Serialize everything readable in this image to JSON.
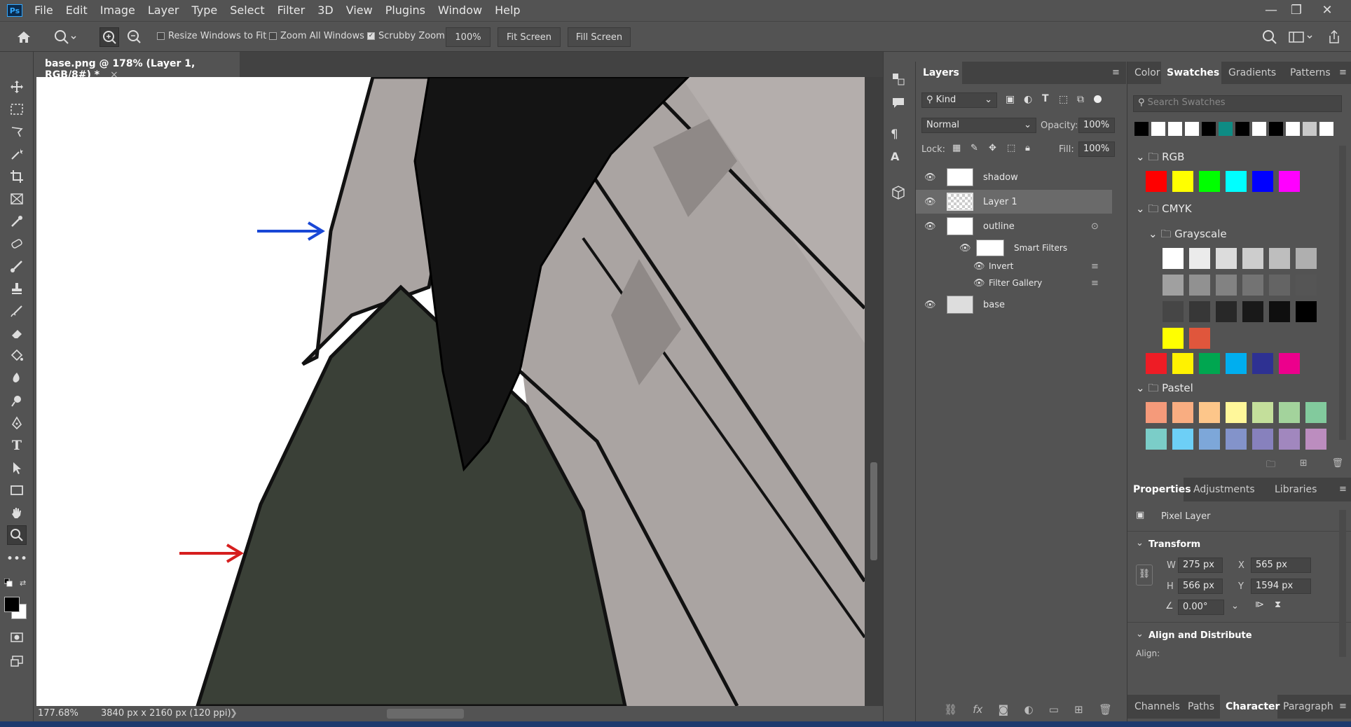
{
  "menu": {
    "app_logo": "Ps",
    "items": [
      "File",
      "Edit",
      "Image",
      "Layer",
      "Type",
      "Select",
      "Filter",
      "3D",
      "View",
      "Plugins",
      "Window",
      "Help"
    ]
  },
  "window_controls": {
    "minimize": "—",
    "restore": "❐",
    "close": "✕"
  },
  "options_bar": {
    "resize_windows": {
      "label": "Resize Windows to Fit",
      "checked": false
    },
    "zoom_all": {
      "label": "Zoom All Windows",
      "checked": false
    },
    "scrubby_zoom": {
      "label": "Scrubby Zoom",
      "checked": true
    },
    "zoom_value": "100%",
    "fit_screen": "Fit Screen",
    "fill_screen": "Fill Screen"
  },
  "document_tab": {
    "title": "base.png @ 178% (Layer 1, RGB/8#) *",
    "close": "×"
  },
  "status": {
    "zoom": "177.68%",
    "dimensions": "3840 px x 2160 px (120 ppi)",
    "arrow": "❯"
  },
  "layers_panel": {
    "tab": "Layers",
    "filter_kind": "Kind",
    "blend_mode": "Normal",
    "opacity_label": "Opacity:",
    "opacity": "100%",
    "lock_label": "Lock:",
    "fill_label": "Fill:",
    "fill": "100%",
    "layers": [
      {
        "name": "shadow",
        "selected": false
      },
      {
        "name": "Layer 1",
        "selected": true
      },
      {
        "name": "outline",
        "selected": false
      },
      {
        "name": "base",
        "selected": false
      }
    ],
    "smart_filters": {
      "label": "Smart Filters",
      "items": [
        "Invert",
        "Filter Gallery"
      ]
    }
  },
  "swatches_panel": {
    "tabs": [
      "Color",
      "Swatches",
      "Gradients",
      "Patterns"
    ],
    "active_tab": "Swatches",
    "search_placeholder": "Search Swatches",
    "recent": [
      "#000000",
      "#ffffff",
      "#ffffff",
      "#ffffff",
      "#000000",
      "#0e8c84",
      "#000000",
      "#ffffff",
      "#000000",
      "#ffffff",
      "#c8c8c8",
      "#ffffff"
    ],
    "groups": {
      "rgb": {
        "name": "RGB",
        "colors": [
          "#ff0000",
          "#ffff00",
          "#00ff00",
          "#00ffff",
          "#0000ff",
          "#ff00ff"
        ]
      },
      "cmyk": {
        "name": "CMYK"
      },
      "grayscale": {
        "name": "Grayscale",
        "colors": [
          "#ffffff",
          "#ebebeb",
          "#dcdcdc",
          "#cdcdcd",
          "#bebebe",
          "#afafaf",
          "#a0a0a0",
          "#919191",
          "#828282",
          "#737373",
          "#646464",
          "#555555",
          "#464646",
          "#373737",
          "#282828",
          "#191919",
          "#0f0f0f",
          "#000000",
          "#ffff00",
          "#e0563c"
        ]
      },
      "cmyk_colors": [
        "#ee1c25",
        "#fff200",
        "#00a650",
        "#00aeef",
        "#2e3192",
        "#ec008c"
      ],
      "pastel": {
        "name": "Pastel",
        "colors": [
          "#f59a7a",
          "#f9ad81",
          "#fdc68a",
          "#fff79a",
          "#c4df9b",
          "#a3d39c",
          "#82ca9d",
          "#7bcdc8",
          "#6dcff6",
          "#7da7d9",
          "#8393ca",
          "#8781bd",
          "#a187be",
          "#bc8dbf"
        ]
      }
    }
  },
  "properties_panel": {
    "tabs": [
      "Properties",
      "Adjustments",
      "Libraries"
    ],
    "active_tab": "Properties",
    "kind": "Pixel Layer",
    "transform_label": "Transform",
    "w_label": "W",
    "w": "275 px",
    "x_label": "X",
    "x": "565 px",
    "h_label": "H",
    "h": "566 px",
    "y_label": "Y",
    "y": "1594 px",
    "angle": "0.00°",
    "align_label": "Align and Distribute",
    "align_sub": "Align:"
  },
  "bottom_tabs": {
    "items": [
      "Channels",
      "Paths",
      "Character",
      "Paragraph"
    ],
    "active": "Character"
  },
  "colors": {
    "blue_arrow": "#1947d6",
    "red_arrow": "#d61e1e",
    "shirt": "#3a4037",
    "hair": "#141414",
    "stone": "#aaa4a2"
  }
}
